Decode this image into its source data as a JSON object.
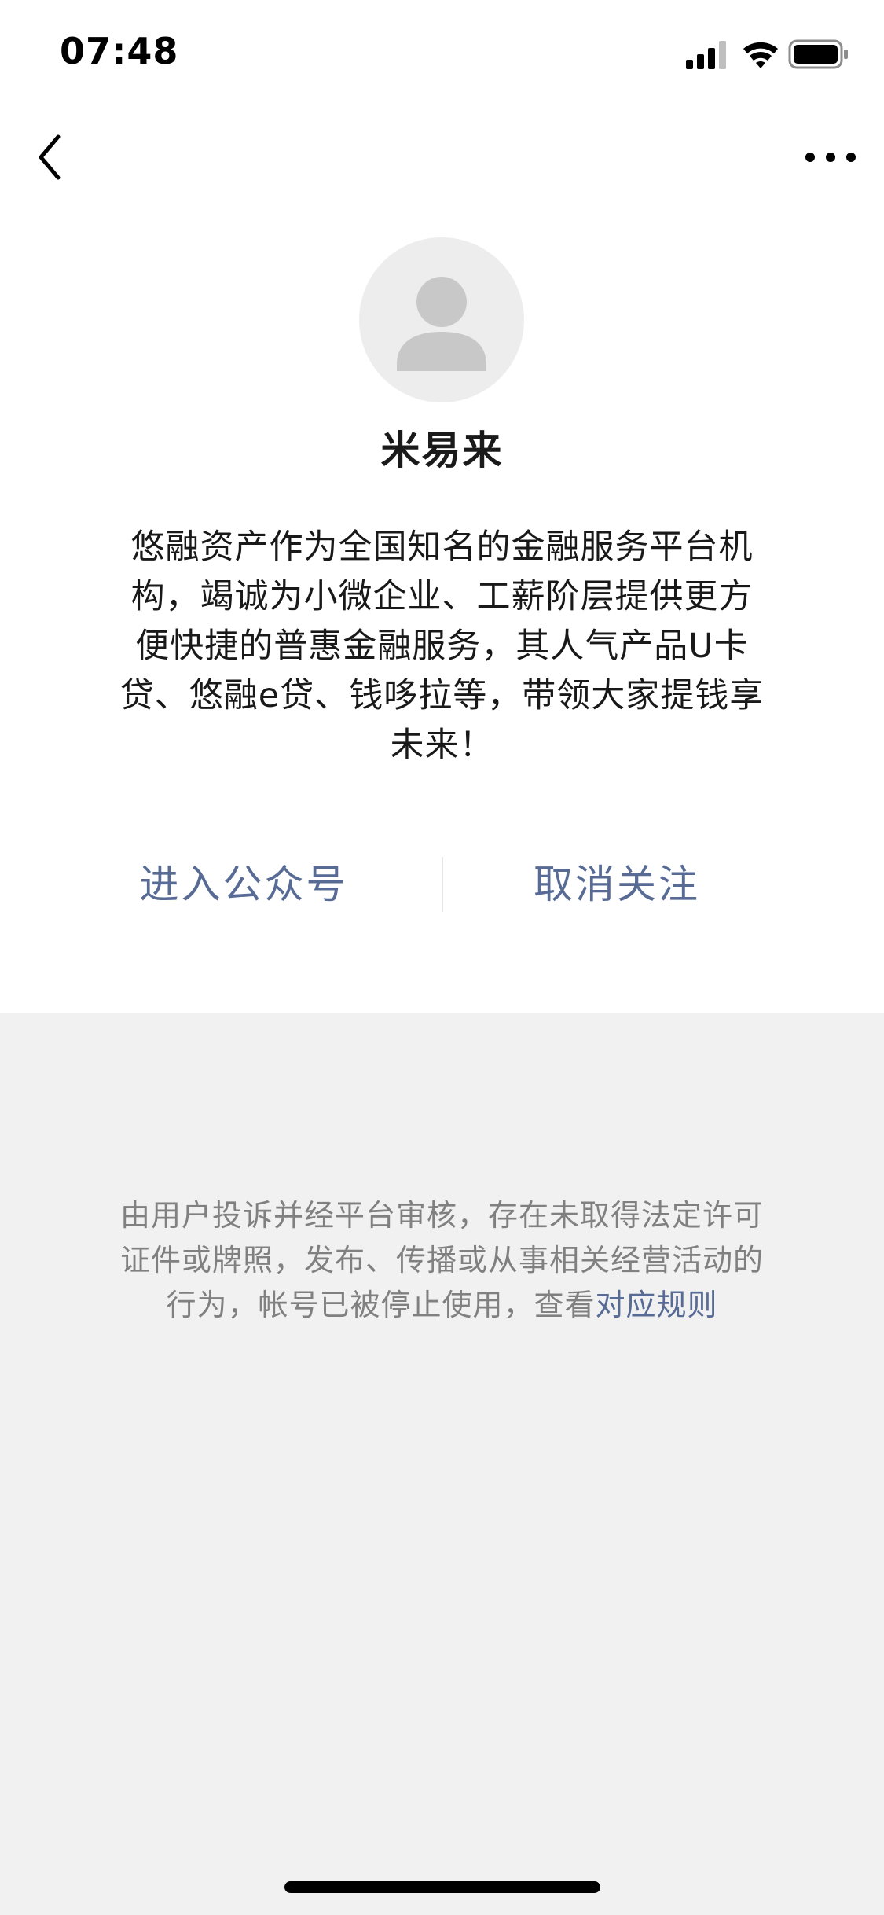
{
  "status_bar": {
    "time": "07:48",
    "icons": [
      "cellular-signal-icon",
      "wifi-icon",
      "battery-icon"
    ]
  },
  "nav": {
    "back_icon": "chevron-left-icon",
    "more_icon": "more-dots-icon"
  },
  "profile": {
    "avatar_icon": "default-avatar-icon",
    "name": "米易来",
    "description": "悠融资产作为全国知名的金融服务平台机构，竭诚为小微企业、工薪阶层提供更方便快捷的普惠金融服务，其人气产品U卡贷、悠融e贷、钱哆拉等，带领大家提钱享未来！"
  },
  "actions": {
    "enter_label": "进入公众号",
    "unfollow_label": "取消关注"
  },
  "notice": {
    "text": "由用户投诉并经平台审核，存在未取得法定许可证件或牌照，发布、传播或从事相关经营活动的行为，帐号已被停止使用，查看",
    "link_text": "对应规则"
  },
  "colors": {
    "link": "#576b95",
    "page_background": "#f1f1f1",
    "card_background": "#ffffff"
  }
}
